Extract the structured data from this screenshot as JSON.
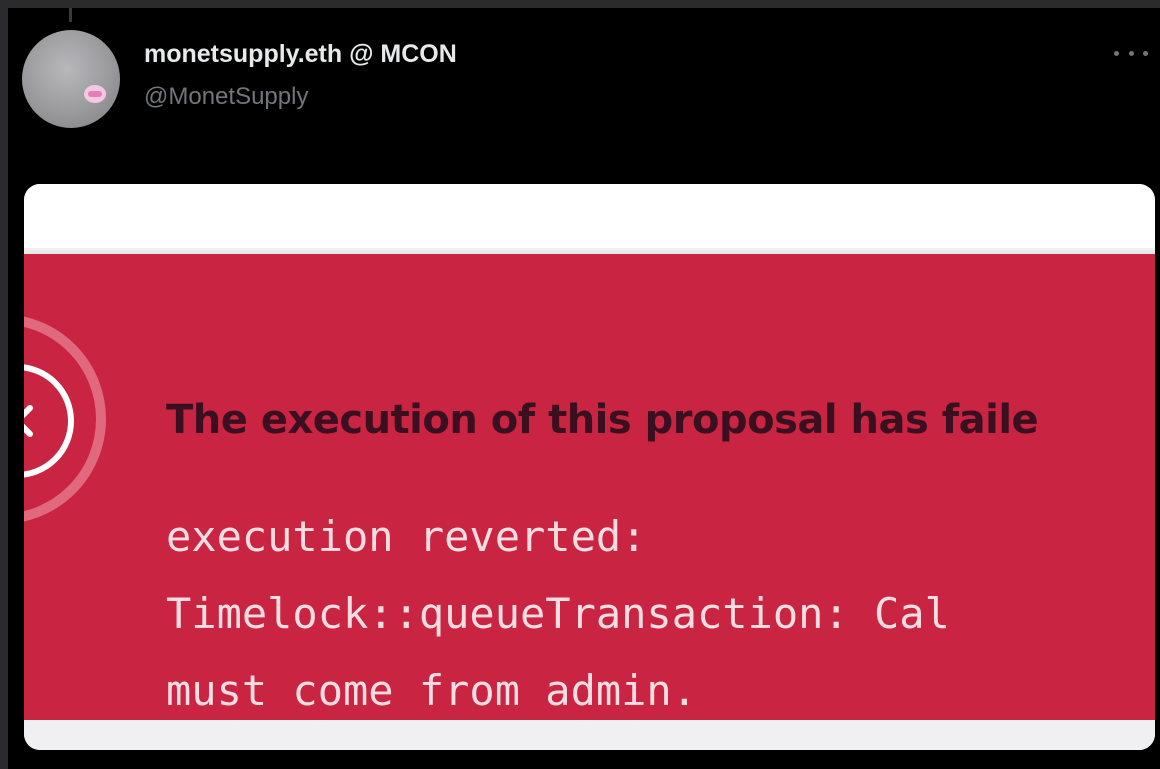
{
  "tweet": {
    "display_name": "monetsupply.eth @ MCON",
    "handle": "@MonetSupply"
  },
  "error_card": {
    "title": "The execution of this proposal has faile",
    "message_lines": [
      "execution reverted:",
      "Timelock::queueTransaction: Cal",
      "must come from admin."
    ],
    "panel_color": "#c92441"
  },
  "icons": {
    "error_icon": "circle-x-icon",
    "more_icon": "more-horizontal-icon"
  }
}
